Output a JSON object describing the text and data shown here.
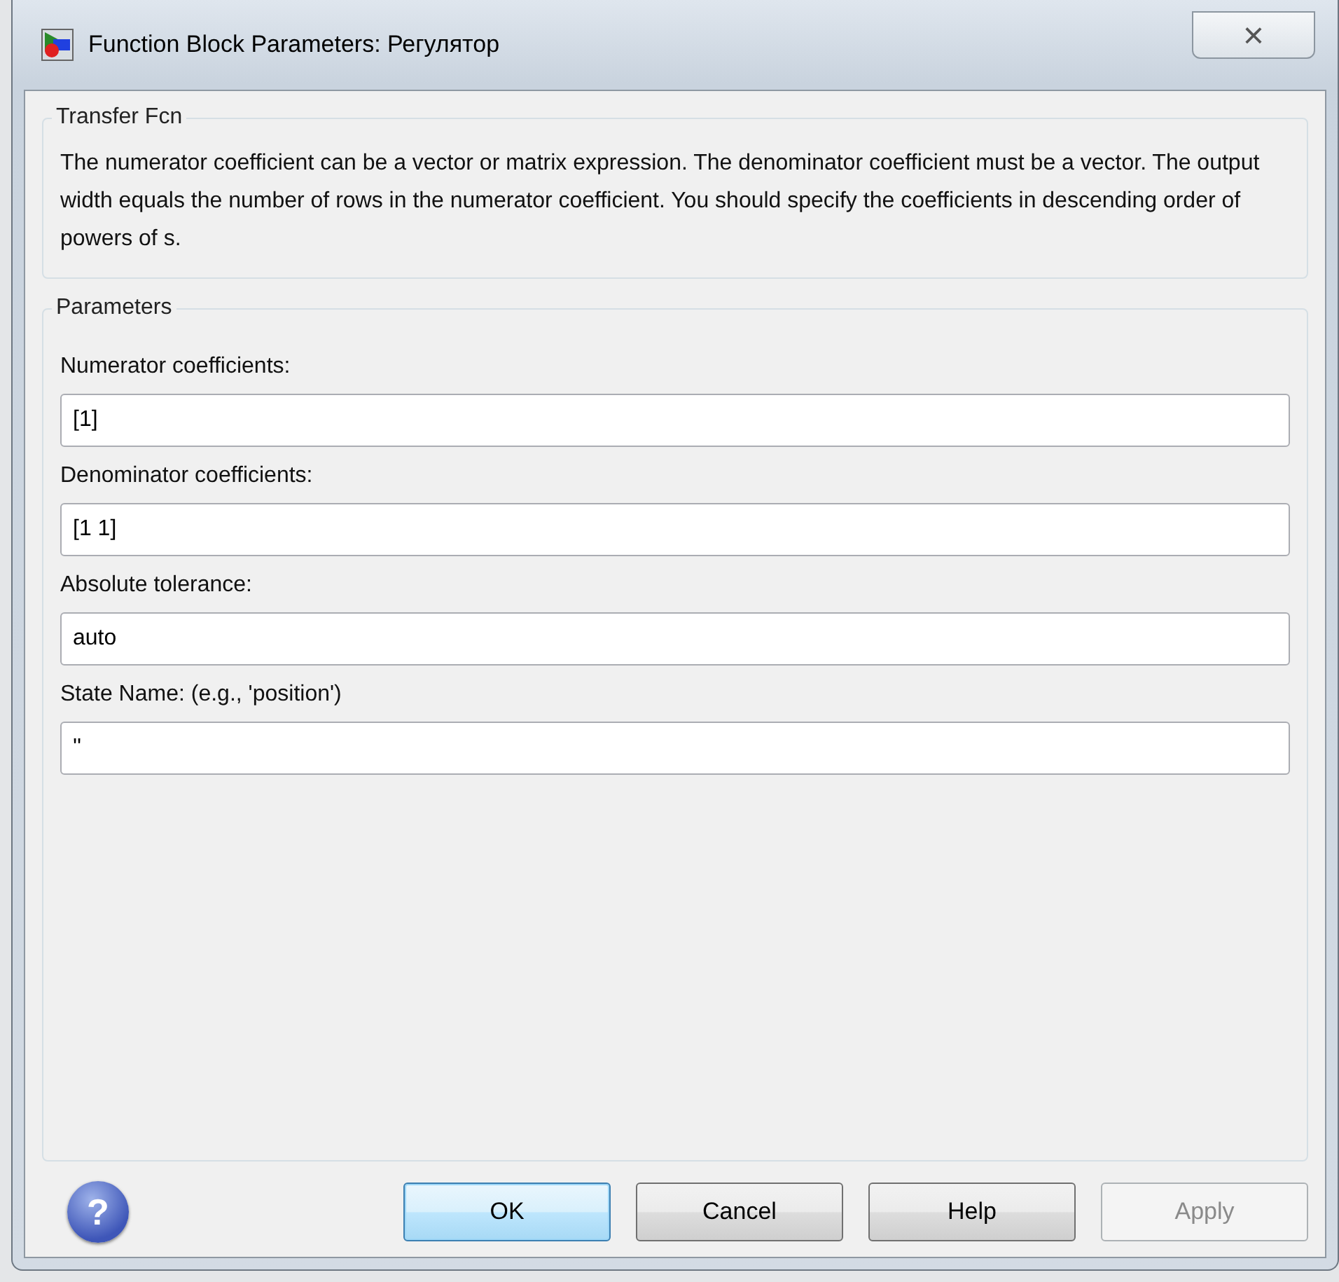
{
  "window": {
    "title": "Function Block Parameters: Регулятор",
    "close": "×"
  },
  "description_group": {
    "title": "Transfer Fcn",
    "text": "The numerator coefficient can be a vector or matrix expression. The denominator coefficient must be a vector. The output width equals the number of rows in the numerator coefficient. You should specify the coefficients in descending order of powers of s."
  },
  "parameters_group": {
    "title": "Parameters",
    "fields": [
      {
        "label": "Numerator coefficients:",
        "value": "[1]"
      },
      {
        "label": "Denominator coefficients:",
        "value": "[1 1]"
      },
      {
        "label": "Absolute tolerance:",
        "value": "auto"
      },
      {
        "label": "State Name: (e.g., 'position')",
        "value": "''"
      }
    ]
  },
  "help_icon": "?",
  "buttons": [
    {
      "label": "OK",
      "default": true,
      "disabled": false
    },
    {
      "label": "Cancel",
      "default": false,
      "disabled": false
    },
    {
      "label": "Help",
      "default": false,
      "disabled": false
    },
    {
      "label": "Apply",
      "default": false,
      "disabled": true
    }
  ]
}
